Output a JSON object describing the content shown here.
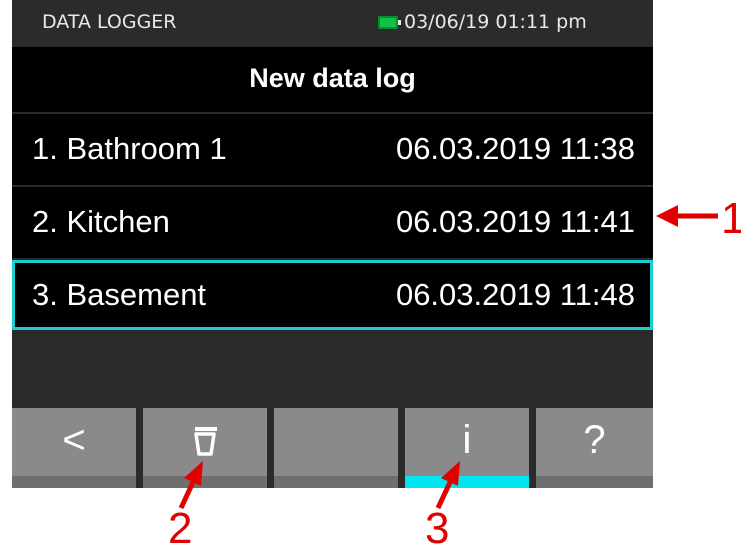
{
  "status_bar": {
    "title": "DATA LOGGER",
    "battery_icon": "battery-full-icon",
    "datetime": "03/06/19 01:11 pm"
  },
  "header": {
    "title": "New data log"
  },
  "logs": [
    {
      "name": "1. Bathroom 1",
      "timestamp": "06.03.2019 11:38",
      "selected": false
    },
    {
      "name": "2. Kitchen",
      "timestamp": "06.03.2019 11:41",
      "selected": false
    },
    {
      "name": "3. Basement",
      "timestamp": "06.03.2019 11:48",
      "selected": true
    }
  ],
  "toolbar": {
    "back_glyph": "<",
    "delete_icon": "trash-icon",
    "info_glyph": "i",
    "help_glyph": "?"
  },
  "callouts": {
    "one": "1",
    "two": "2",
    "three": "3"
  },
  "colors": {
    "accent": "#19cfd4",
    "active_tab": "#00e5ee",
    "annotation": "#e00000",
    "battery": "#11c24a"
  }
}
